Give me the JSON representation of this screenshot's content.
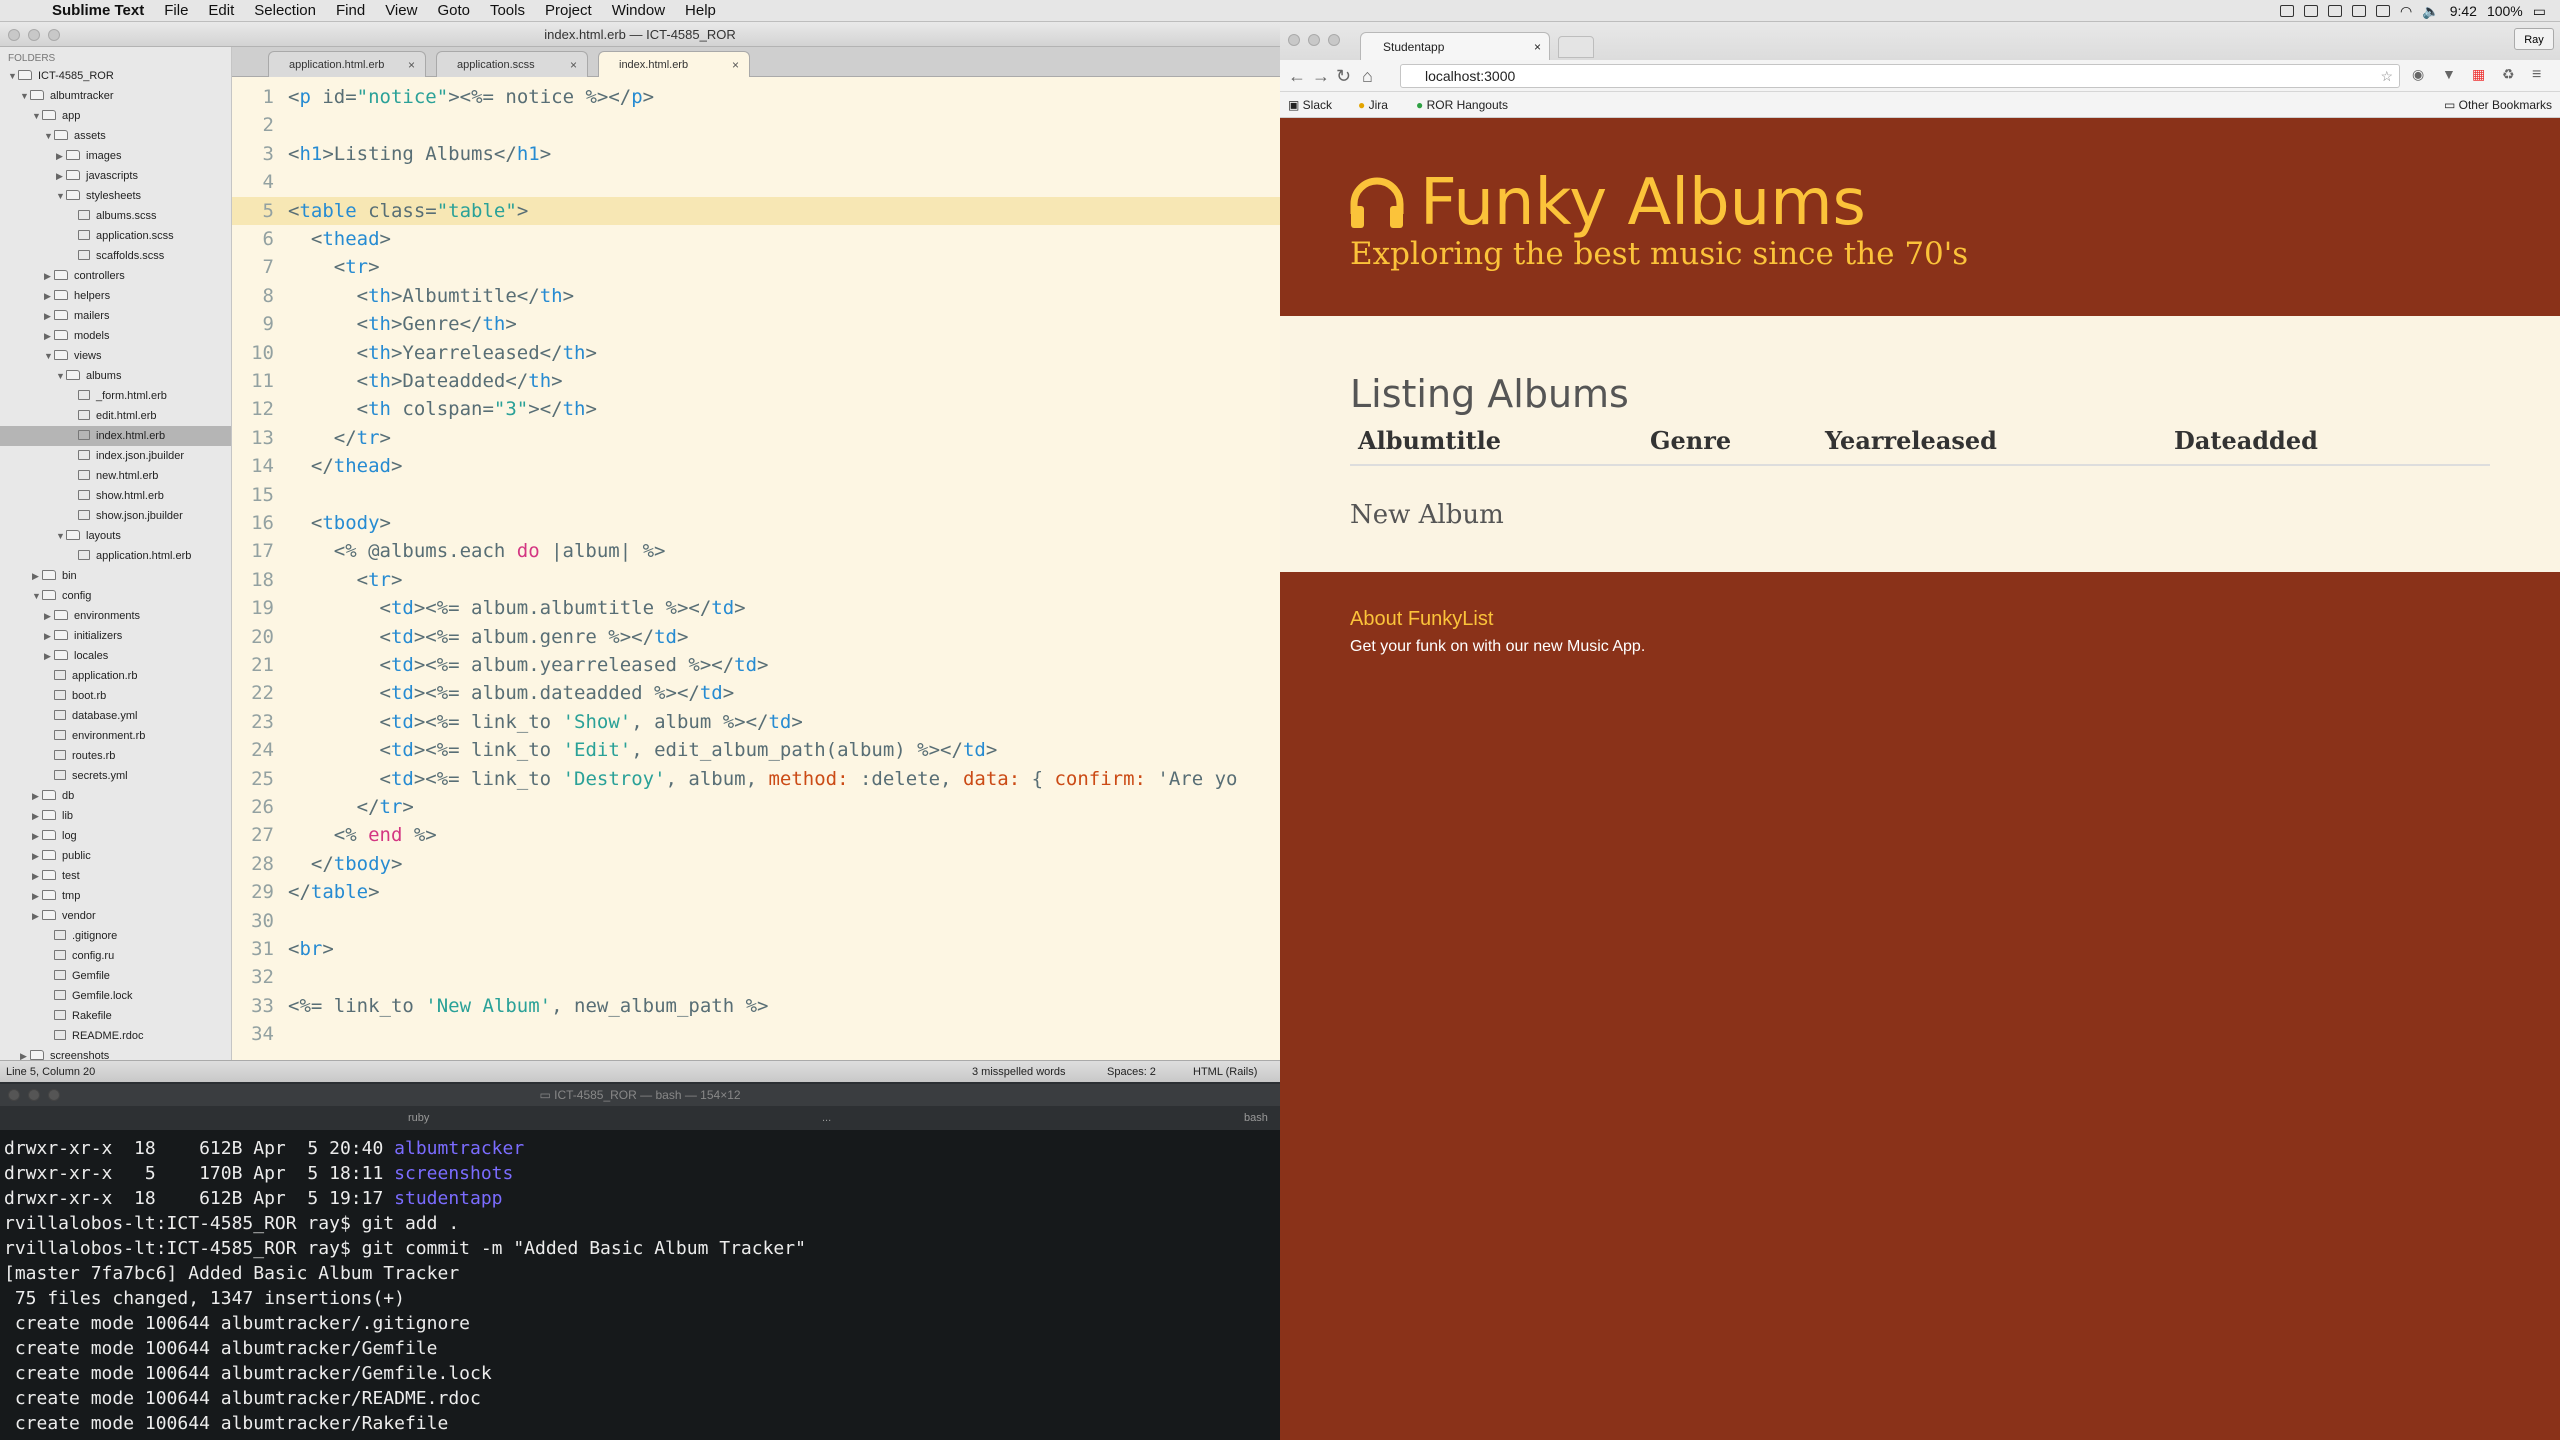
{
  "menubar": {
    "app_name": "Sublime Text",
    "items": [
      "File",
      "Edit",
      "Selection",
      "Find",
      "View",
      "Goto",
      "Tools",
      "Project",
      "Window",
      "Help"
    ],
    "time": "9:42",
    "battery": "100%"
  },
  "sublime": {
    "window_title": "index.html.erb — ICT-4585_ROR",
    "sidebar_header": "FOLDERS",
    "tree": [
      {
        "label": "ICT-4585_ROR",
        "depth": 0,
        "kind": "open"
      },
      {
        "label": "albumtracker",
        "depth": 1,
        "kind": "open"
      },
      {
        "label": "app",
        "depth": 2,
        "kind": "open"
      },
      {
        "label": "assets",
        "depth": 3,
        "kind": "open"
      },
      {
        "label": "images",
        "depth": 4,
        "kind": "closed"
      },
      {
        "label": "javascripts",
        "depth": 4,
        "kind": "closed"
      },
      {
        "label": "stylesheets",
        "depth": 4,
        "kind": "open"
      },
      {
        "label": "albums.scss",
        "depth": 5,
        "kind": "file"
      },
      {
        "label": "application.scss",
        "depth": 5,
        "kind": "file"
      },
      {
        "label": "scaffolds.scss",
        "depth": 5,
        "kind": "file"
      },
      {
        "label": "controllers",
        "depth": 3,
        "kind": "closed"
      },
      {
        "label": "helpers",
        "depth": 3,
        "kind": "closed"
      },
      {
        "label": "mailers",
        "depth": 3,
        "kind": "closed"
      },
      {
        "label": "models",
        "depth": 3,
        "kind": "closed"
      },
      {
        "label": "views",
        "depth": 3,
        "kind": "open"
      },
      {
        "label": "albums",
        "depth": 4,
        "kind": "open"
      },
      {
        "label": "_form.html.erb",
        "depth": 5,
        "kind": "file"
      },
      {
        "label": "edit.html.erb",
        "depth": 5,
        "kind": "file"
      },
      {
        "label": "index.html.erb",
        "depth": 5,
        "kind": "file",
        "selected": true
      },
      {
        "label": "index.json.jbuilder",
        "depth": 5,
        "kind": "file"
      },
      {
        "label": "new.html.erb",
        "depth": 5,
        "kind": "file"
      },
      {
        "label": "show.html.erb",
        "depth": 5,
        "kind": "file"
      },
      {
        "label": "show.json.jbuilder",
        "depth": 5,
        "kind": "file"
      },
      {
        "label": "layouts",
        "depth": 4,
        "kind": "open"
      },
      {
        "label": "application.html.erb",
        "depth": 5,
        "kind": "file"
      },
      {
        "label": "bin",
        "depth": 2,
        "kind": "closed"
      },
      {
        "label": "config",
        "depth": 2,
        "kind": "open"
      },
      {
        "label": "environments",
        "depth": 3,
        "kind": "closed"
      },
      {
        "label": "initializers",
        "depth": 3,
        "kind": "closed"
      },
      {
        "label": "locales",
        "depth": 3,
        "kind": "closed"
      },
      {
        "label": "application.rb",
        "depth": 3,
        "kind": "file"
      },
      {
        "label": "boot.rb",
        "depth": 3,
        "kind": "file"
      },
      {
        "label": "database.yml",
        "depth": 3,
        "kind": "file"
      },
      {
        "label": "environment.rb",
        "depth": 3,
        "kind": "file"
      },
      {
        "label": "routes.rb",
        "depth": 3,
        "kind": "file"
      },
      {
        "label": "secrets.yml",
        "depth": 3,
        "kind": "file"
      },
      {
        "label": "db",
        "depth": 2,
        "kind": "closed"
      },
      {
        "label": "lib",
        "depth": 2,
        "kind": "closed"
      },
      {
        "label": "log",
        "depth": 2,
        "kind": "closed"
      },
      {
        "label": "public",
        "depth": 2,
        "kind": "closed"
      },
      {
        "label": "test",
        "depth": 2,
        "kind": "closed"
      },
      {
        "label": "tmp",
        "depth": 2,
        "kind": "closed"
      },
      {
        "label": "vendor",
        "depth": 2,
        "kind": "closed"
      },
      {
        "label": ".gitignore",
        "depth": 3,
        "kind": "file"
      },
      {
        "label": "config.ru",
        "depth": 3,
        "kind": "file"
      },
      {
        "label": "Gemfile",
        "depth": 3,
        "kind": "file"
      },
      {
        "label": "Gemfile.lock",
        "depth": 3,
        "kind": "file"
      },
      {
        "label": "Rakefile",
        "depth": 3,
        "kind": "file"
      },
      {
        "label": "README.rdoc",
        "depth": 3,
        "kind": "file"
      },
      {
        "label": "screenshots",
        "depth": 1,
        "kind": "closed"
      }
    ],
    "tabs": [
      {
        "label": "application.html.erb",
        "active": false
      },
      {
        "label": "application.scss",
        "active": false
      },
      {
        "label": "index.html.erb",
        "active": true
      }
    ],
    "current_line": 5,
    "code_lines": [
      "<p id=\"notice\"><%= notice %></p>",
      "",
      "<h1>Listing Albums</h1>",
      "",
      "<table class=\"table\">",
      "  <thead>",
      "    <tr>",
      "      <th>Albumtitle</th>",
      "      <th>Genre</th>",
      "      <th>Yearreleased</th>",
      "      <th>Dateadded</th>",
      "      <th colspan=\"3\"></th>",
      "    </tr>",
      "  </thead>",
      "",
      "  <tbody>",
      "    <% @albums.each do |album| %>",
      "      <tr>",
      "        <td><%= album.albumtitle %></td>",
      "        <td><%= album.genre %></td>",
      "        <td><%= album.yearreleased %></td>",
      "        <td><%= album.dateadded %></td>",
      "        <td><%= link_to 'Show', album %></td>",
      "        <td><%= link_to 'Edit', edit_album_path(album) %></td>",
      "        <td><%= link_to 'Destroy', album, method: :delete, data: { confirm: 'Are yo",
      "      </tr>",
      "    <% end %>",
      "  </tbody>",
      "</table>",
      "",
      "<br>",
      "",
      "<%= link_to 'New Album', new_album_path %>",
      ""
    ],
    "status": {
      "position": "Line 5, Column 20",
      "spelling": "3 misspelled words",
      "indent": "Spaces: 2",
      "syntax": "HTML (Rails)"
    }
  },
  "terminal": {
    "title": "ICT-4585_ROR — bash — 154×12",
    "tab_left": "ruby",
    "tab_mid": "...",
    "tab_right": "bash",
    "lines": [
      {
        "text": "drwxr-xr-x  18    612B Apr  5 20:40 ",
        "dir": "albumtracker"
      },
      {
        "text": "drwxr-xr-x   5    170B Apr  5 18:11 ",
        "dir": "screenshots"
      },
      {
        "text": "drwxr-xr-x  18    612B Apr  5 19:17 ",
        "dir": "studentapp"
      },
      {
        "text": "rvillalobos-lt:ICT-4585_ROR ray$ git add .",
        "dir": ""
      },
      {
        "text": "rvillalobos-lt:ICT-4585_ROR ray$ git commit -m \"Added Basic Album Tracker\"",
        "dir": ""
      },
      {
        "text": "[master 7fa7bc6] Added Basic Album Tracker",
        "dir": ""
      },
      {
        "text": " 75 files changed, 1347 insertions(+)",
        "dir": ""
      },
      {
        "text": " create mode 100644 albumtracker/.gitignore",
        "dir": ""
      },
      {
        "text": " create mode 100644 albumtracker/Gemfile",
        "dir": ""
      },
      {
        "text": " create mode 100644 albumtracker/Gemfile.lock",
        "dir": ""
      },
      {
        "text": " create mode 100644 albumtracker/README.rdoc",
        "dir": ""
      },
      {
        "text": " create mode 100644 albumtracker/Rakefile",
        "dir": ""
      }
    ]
  },
  "chrome": {
    "tab_title": "Studentapp",
    "profile": "Ray",
    "url": "localhost:3000",
    "bookmarks": [
      "Slack",
      "Jira",
      "ROR Hangouts"
    ],
    "other_bookmarks": "Other Bookmarks"
  },
  "site": {
    "title": "Funky Albums",
    "subtitle": "Exploring the best music since the 70's",
    "heading": "Listing Albums",
    "columns": [
      "Albumtitle",
      "Genre",
      "Yearreleased",
      "Dateadded"
    ],
    "new_album": "New Album",
    "footer_title": "About FunkyList",
    "footer_text": "Get your funk on with our new Music App.",
    "colors": {
      "brand_bg": "#8a3219",
      "brand_accent": "#fbc33a",
      "content_bg": "#fbf4e3"
    }
  }
}
